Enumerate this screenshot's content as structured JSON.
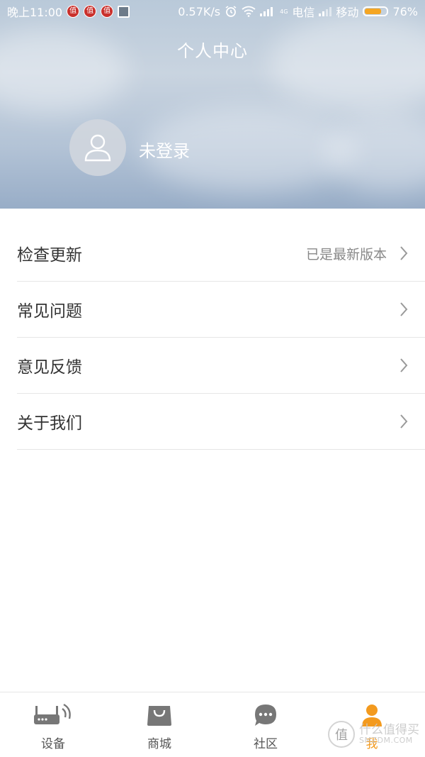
{
  "status_bar": {
    "time": "晚上11:00",
    "app_badge": "值",
    "network_speed": "0.57K/s",
    "carrier1": "电信",
    "carrier2": "移动",
    "battery_percent": "76%",
    "battery_level": 0.76,
    "network_type": "4G"
  },
  "header": {
    "title": "个人中心",
    "login_text": "未登录"
  },
  "menu": {
    "items": [
      {
        "label": "检查更新",
        "value": "已是最新版本"
      },
      {
        "label": "常见问题",
        "value": ""
      },
      {
        "label": "意见反馈",
        "value": ""
      },
      {
        "label": "关于我们",
        "value": ""
      }
    ]
  },
  "tabbar": {
    "tabs": [
      {
        "label": "设备",
        "icon": "router-icon"
      },
      {
        "label": "商城",
        "icon": "shopping-bag-icon"
      },
      {
        "label": "社区",
        "icon": "chat-bubble-icon"
      },
      {
        "label": "我",
        "icon": "person-icon",
        "active": true
      }
    ]
  },
  "watermark": {
    "logo": "值",
    "cn": "什么值得买",
    "en": "SMZDM.COM"
  },
  "colors": {
    "accent": "#f39a1e",
    "inactive_icon": "#777777",
    "header_sky": "#b9c9d9"
  }
}
